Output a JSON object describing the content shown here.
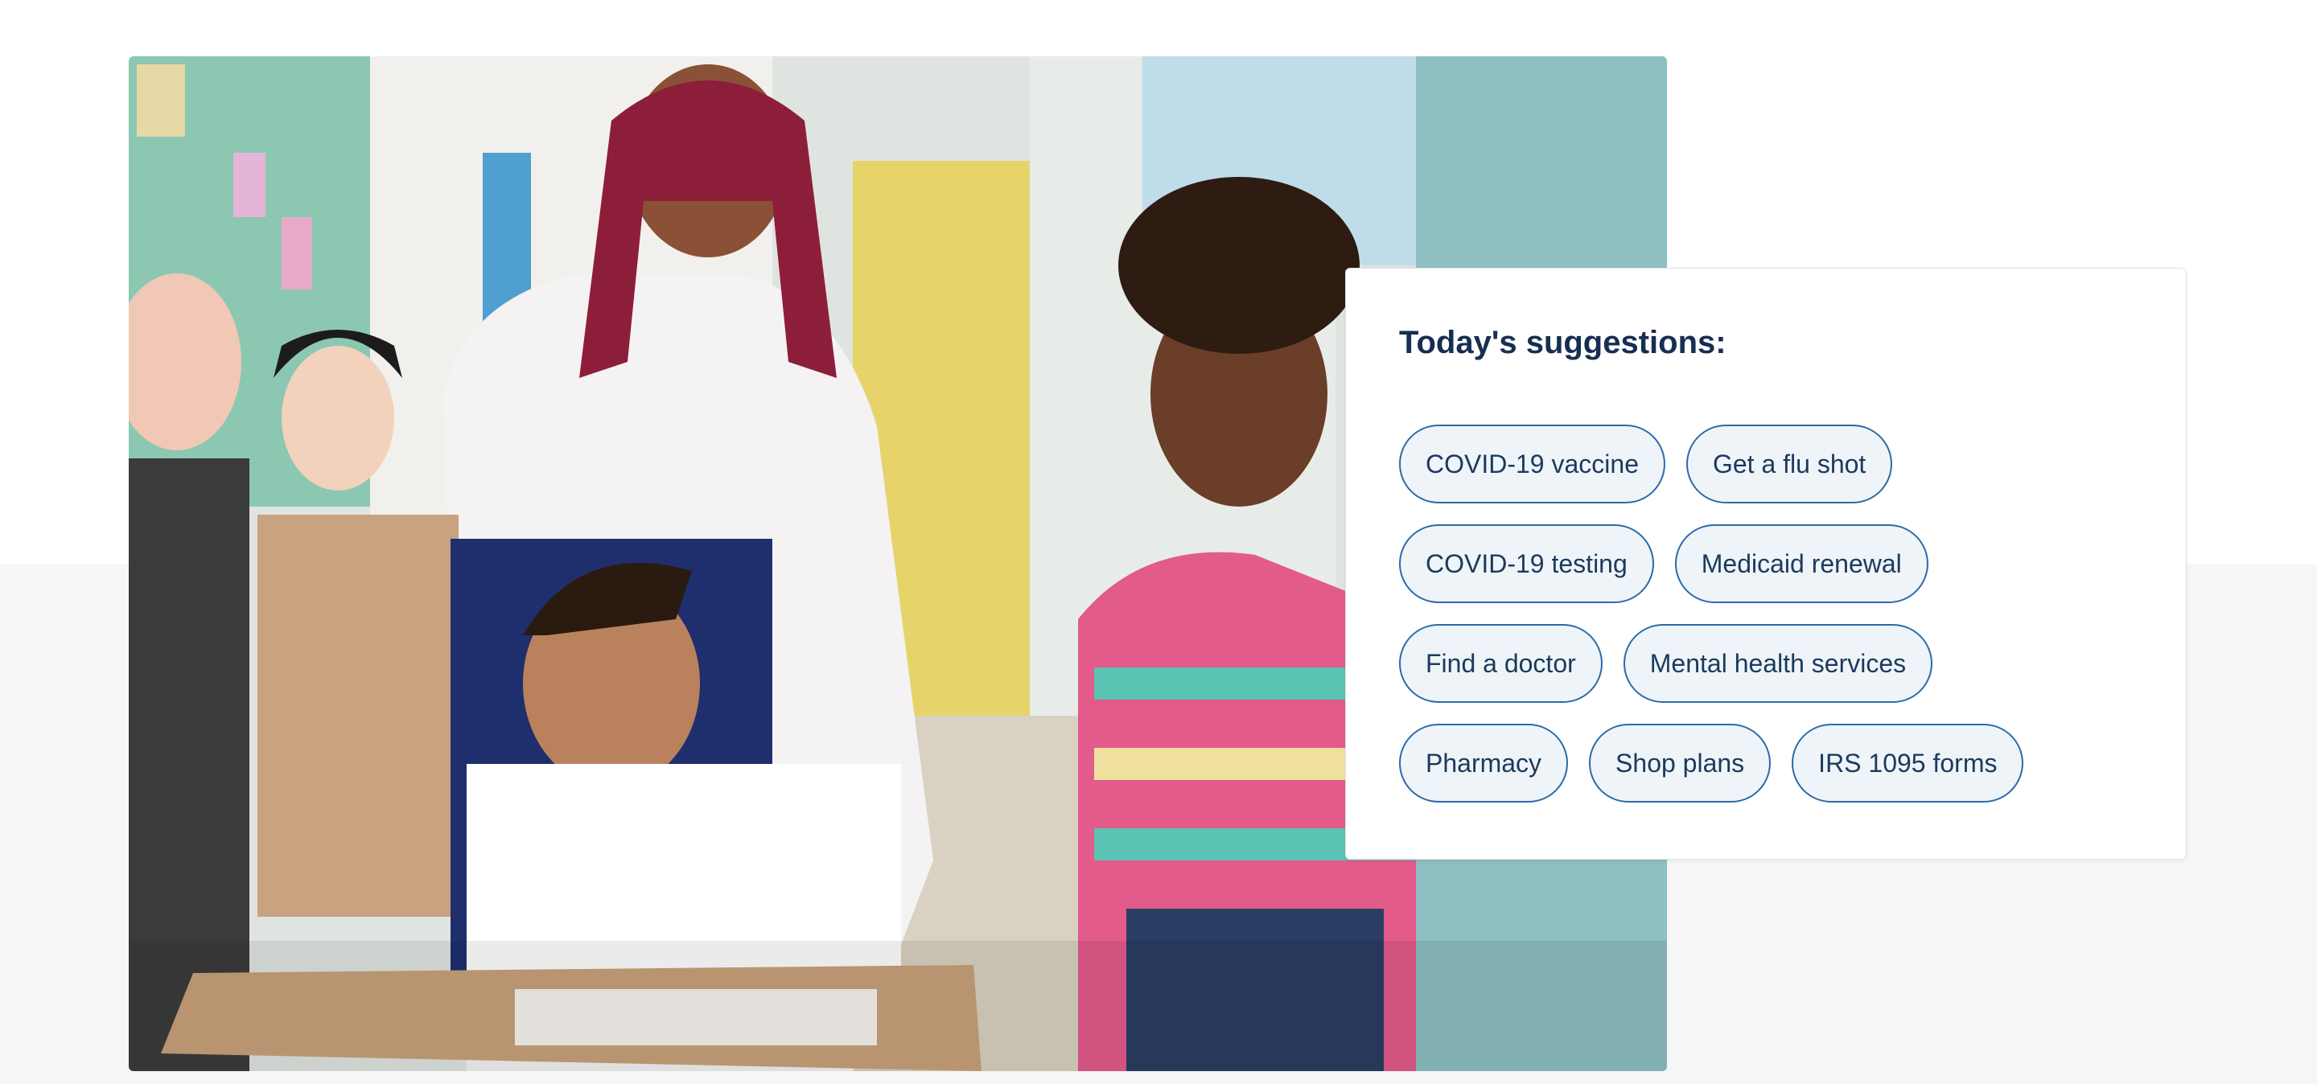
{
  "suggestions": {
    "title": "Today's suggestions:",
    "rows": [
      [
        "COVID-19 vaccine",
        "Get a flu shot"
      ],
      [
        "COVID-19 testing",
        "Medicaid renewal"
      ],
      [
        "Find a doctor",
        "Mental health services"
      ],
      [
        "Pharmacy",
        "Shop plans",
        "IRS 1095 forms"
      ]
    ]
  },
  "colors": {
    "heading": "#162e51",
    "chip_border": "#2b6ba8",
    "chip_background": "#eff4f9",
    "chip_text": "#1b3a5c",
    "page_band": "#f6f6f6"
  }
}
